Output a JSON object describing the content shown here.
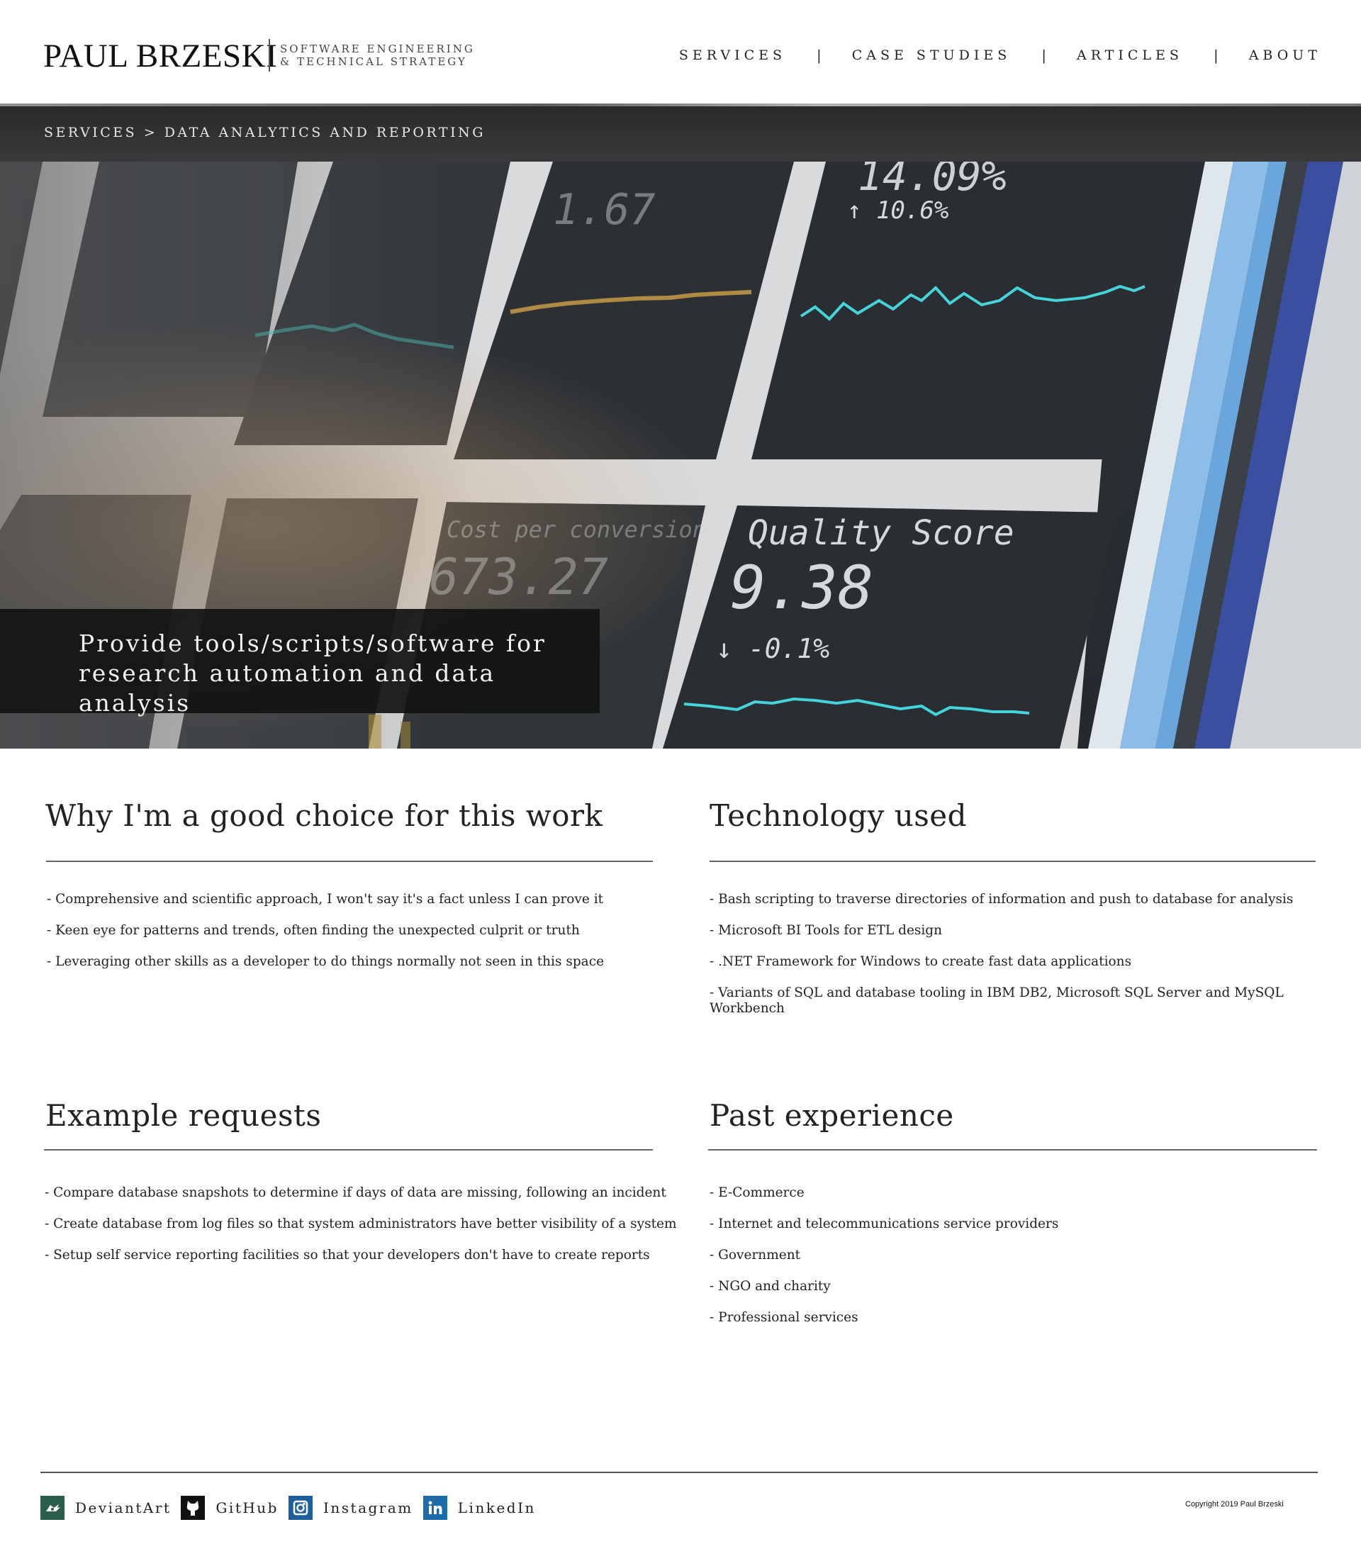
{
  "brand": {
    "name": "PAUL BRZESKI",
    "tagline_line1": "SOFTWARE ENGINEERING",
    "tagline_line2": "& TECHNICAL STRATEGY"
  },
  "nav": {
    "items": [
      {
        "label": "SERVICES"
      },
      {
        "label": "CASE STUDIES"
      },
      {
        "label": "ARTICLES"
      },
      {
        "label": "ABOUT"
      }
    ],
    "separator": "|"
  },
  "breadcrumb": {
    "parent": "SERVICES",
    "separator": ">",
    "current": "DATA ANALYTICS AND REPORTING"
  },
  "hero": {
    "caption_line1": "Provide tools/scripts/software for",
    "caption_line2": "research automation and data analysis",
    "image_text": {
      "tile_top_right_value": "14.09%",
      "tile_top_right_delta": "↑ 10.6%",
      "tile_top_mid_value": "1.67",
      "tile_bottom_label": "Cost per conversion",
      "tile_bottom_value": "673.27",
      "quality_label": "Quality Score",
      "quality_value": "9.38",
      "quality_delta": "↓ -0.1%"
    }
  },
  "sections": {
    "why": {
      "title": "Why I'm a good choice for this work",
      "items": [
        "- Comprehensive and scientific approach, I won't say it's a fact unless I can prove it",
        "- Keen eye for patterns and trends, often finding the unexpected culprit or truth",
        "- Leveraging other skills as a developer to do things normally not seen in this space"
      ]
    },
    "tech": {
      "title": "Technology used",
      "items": [
        "- Bash scripting to traverse directories of information and push to database for analysis",
        "- Microsoft BI Tools for ETL design",
        "- .NET Framework for Windows to create fast data applications",
        "- Variants of SQL and database tooling in IBM DB2, Microsoft SQL Server and MySQL Workbench"
      ]
    },
    "examples": {
      "title": "Example requests",
      "items": [
        "- Compare database snapshots to determine if days of data are missing, following an incident",
        "- Create database from log files so that system administrators have better visibility of a system",
        "- Setup self service reporting facilities so that your developers don't have to create reports"
      ]
    },
    "experience": {
      "title": "Past experience",
      "items": [
        "- E-Commerce",
        "- Internet and telecommunications service providers",
        "- Government",
        "- NGO and charity",
        "- Professional services"
      ]
    }
  },
  "footer": {
    "social": [
      {
        "label": "DeviantArt",
        "icon": "deviantart-icon",
        "color": "#2c5e4e"
      },
      {
        "label": "GitHub",
        "icon": "github-icon",
        "color": "#111111"
      },
      {
        "label": "Instagram",
        "icon": "instagram-icon",
        "color": "#1f5f9e"
      },
      {
        "label": "LinkedIn",
        "icon": "linkedin-icon",
        "color": "#1d6ba8"
      }
    ],
    "copyright": "Copyright 2019 Paul Brzeski"
  }
}
